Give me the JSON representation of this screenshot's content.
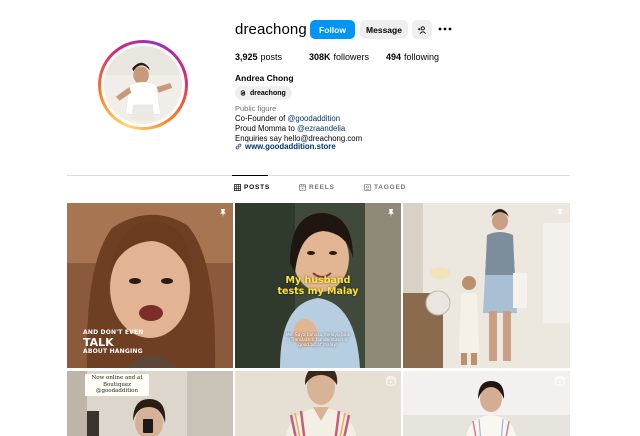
{
  "profile": {
    "username": "dreachong",
    "verified": true,
    "follow_label": "Follow",
    "message_label": "Message",
    "stats": {
      "posts_count": "3,925",
      "posts_label": "posts",
      "followers_count": "308K",
      "followers_label": "followers",
      "following_count": "494",
      "following_label": "following"
    },
    "full_name": "Andrea Chong",
    "threads_handle": "dreachong",
    "category": "Public figure",
    "bio": {
      "line1_prefix": "Co-Founder of ",
      "line1_mention": "@goodaddition",
      "line2_prefix": "Proud Momma to ",
      "line2_mention": "@ezraandelia",
      "line3": "Enquiries say hello@dreachong.com"
    },
    "website": "www.goodaddition.store"
  },
  "tabs": [
    {
      "label": "POSTS",
      "active": true
    },
    {
      "label": "REELS",
      "active": false
    },
    {
      "label": "TAGGED",
      "active": false
    }
  ],
  "posts": [
    {
      "overlay_small_1": "AND DON'T EVEN",
      "overlay_big": "TALK",
      "overlay_small_2": "ABOUT HANGING",
      "pinned": true
    },
    {
      "caption_line1": "My husband",
      "caption_line2": "tests my Malay",
      "subtitle_line1": "Me: Saya bahasa melayu baik",
      "subtitle_line2": "(Translated: I understand a",
      "subtitle_line3": "good bit of malay)",
      "pinned": true
    },
    {
      "pinned": true
    },
    {
      "overlay_line1": "Now online and at",
      "overlay_line2": "Boutiquez @goodaddition",
      "reel": false
    },
    {
      "reel": true
    },
    {
      "reel": true
    }
  ],
  "colors": {
    "accent": "#0095f6",
    "link": "#00376b",
    "muted": "#737373",
    "button_bg": "#efefef",
    "divider": "#dbdbdb"
  },
  "icons": [
    "verified-badge-icon",
    "add-person-icon",
    "more-options-icon",
    "threads-icon",
    "link-icon",
    "grid-icon",
    "reels-icon",
    "tagged-icon",
    "pin-icon",
    "reel-icon"
  ]
}
